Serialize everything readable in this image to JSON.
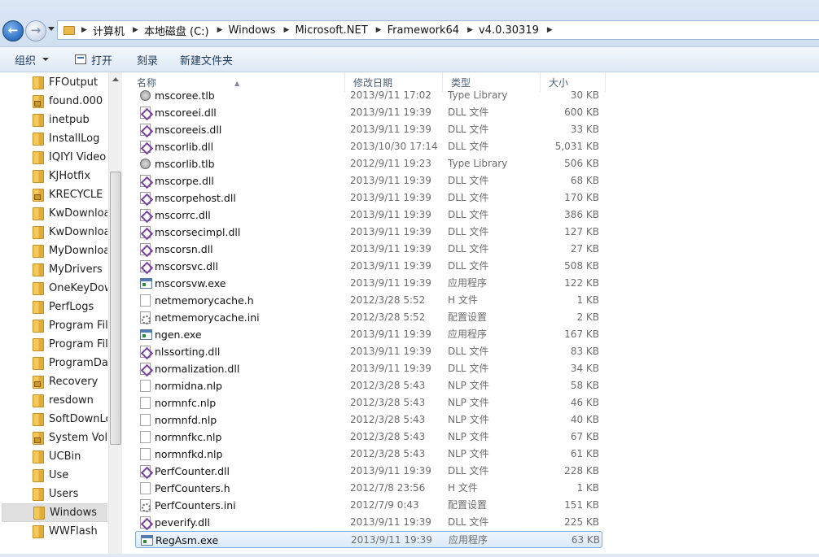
{
  "address": {
    "breadcrumbs": [
      "计算机",
      "本地磁盘 (C:)",
      "Windows",
      "Microsoft.NET",
      "Framework64",
      "v4.0.30319"
    ]
  },
  "toolbar": {
    "organize_label": "组织",
    "open_label": "打开",
    "burn_label": "刻录",
    "new_folder_label": "新建文件夹"
  },
  "navigation": {
    "items": [
      {
        "label": "FFOutput",
        "locked": false
      },
      {
        "label": "found.000",
        "locked": true
      },
      {
        "label": "inetpub",
        "locked": false
      },
      {
        "label": "InstallLog",
        "locked": false
      },
      {
        "label": "IQIYI Video",
        "locked": false
      },
      {
        "label": "KJHotfix",
        "locked": false
      },
      {
        "label": "KRECYCLE",
        "locked": true
      },
      {
        "label": "KwDownload",
        "locked": false
      },
      {
        "label": "KwDownload",
        "locked": false
      },
      {
        "label": "MyDownloads",
        "locked": false
      },
      {
        "label": "MyDrivers",
        "locked": false
      },
      {
        "label": "OneKeyDown",
        "locked": false
      },
      {
        "label": "PerfLogs",
        "locked": false
      },
      {
        "label": "Program Files",
        "locked": false
      },
      {
        "label": "Program Files",
        "locked": false
      },
      {
        "label": "ProgramData",
        "locked": false
      },
      {
        "label": "Recovery",
        "locked": true
      },
      {
        "label": "resdown",
        "locked": false
      },
      {
        "label": "SoftDownLoad",
        "locked": false
      },
      {
        "label": "System Volume",
        "locked": true
      },
      {
        "label": "UCBin",
        "locked": false
      },
      {
        "label": "Use",
        "locked": false
      },
      {
        "label": "Users",
        "locked": false
      },
      {
        "label": "Windows",
        "locked": false
      },
      {
        "label": "WWFlash",
        "locked": false
      }
    ],
    "selected_index": 23
  },
  "file_list": {
    "columns": {
      "name": "名称",
      "date": "修改日期",
      "type": "类型",
      "size": "大小"
    },
    "rows": [
      {
        "name": "mscoree.tlb",
        "date": "2013/9/11 17:02",
        "type": "Type Library",
        "size": "30 KB",
        "icon": "tlb"
      },
      {
        "name": "mscoreei.dll",
        "date": "2013/9/11 19:39",
        "type": "DLL 文件",
        "size": "600 KB",
        "icon": "dll"
      },
      {
        "name": "mscoreeis.dll",
        "date": "2013/9/11 19:39",
        "type": "DLL 文件",
        "size": "33 KB",
        "icon": "dll"
      },
      {
        "name": "mscorlib.dll",
        "date": "2013/10/30 17:14",
        "type": "DLL 文件",
        "size": "5,031 KB",
        "icon": "dll"
      },
      {
        "name": "mscorlib.tlb",
        "date": "2012/9/11 19:23",
        "type": "Type Library",
        "size": "506 KB",
        "icon": "tlb"
      },
      {
        "name": "mscorpe.dll",
        "date": "2013/9/11 19:39",
        "type": "DLL 文件",
        "size": "68 KB",
        "icon": "dll"
      },
      {
        "name": "mscorpehost.dll",
        "date": "2013/9/11 19:39",
        "type": "DLL 文件",
        "size": "170 KB",
        "icon": "dll"
      },
      {
        "name": "mscorrc.dll",
        "date": "2013/9/11 19:39",
        "type": "DLL 文件",
        "size": "386 KB",
        "icon": "dll"
      },
      {
        "name": "mscorsecimpl.dll",
        "date": "2013/9/11 19:39",
        "type": "DLL 文件",
        "size": "127 KB",
        "icon": "dll"
      },
      {
        "name": "mscorsn.dll",
        "date": "2013/9/11 19:39",
        "type": "DLL 文件",
        "size": "27 KB",
        "icon": "dll"
      },
      {
        "name": "mscorsvc.dll",
        "date": "2013/9/11 19:39",
        "type": "DLL 文件",
        "size": "508 KB",
        "icon": "dll"
      },
      {
        "name": "mscorsvw.exe",
        "date": "2013/9/11 19:39",
        "type": "应用程序",
        "size": "122 KB",
        "icon": "exe"
      },
      {
        "name": "netmemorycache.h",
        "date": "2012/3/28 5:52",
        "type": "H 文件",
        "size": "1 KB",
        "icon": "h"
      },
      {
        "name": "netmemorycache.ini",
        "date": "2012/3/28 5:52",
        "type": "配置设置",
        "size": "2 KB",
        "icon": "ini"
      },
      {
        "name": "ngen.exe",
        "date": "2013/9/11 19:39",
        "type": "应用程序",
        "size": "167 KB",
        "icon": "exe"
      },
      {
        "name": "nlssorting.dll",
        "date": "2013/9/11 19:39",
        "type": "DLL 文件",
        "size": "83 KB",
        "icon": "dll"
      },
      {
        "name": "normalization.dll",
        "date": "2013/9/11 19:39",
        "type": "DLL 文件",
        "size": "34 KB",
        "icon": "dll"
      },
      {
        "name": "normidna.nlp",
        "date": "2012/3/28 5:43",
        "type": "NLP 文件",
        "size": "58 KB",
        "icon": "nlp"
      },
      {
        "name": "normnfc.nlp",
        "date": "2012/3/28 5:43",
        "type": "NLP 文件",
        "size": "46 KB",
        "icon": "nlp"
      },
      {
        "name": "normnfd.nlp",
        "date": "2012/3/28 5:43",
        "type": "NLP 文件",
        "size": "40 KB",
        "icon": "nlp"
      },
      {
        "name": "normnfkc.nlp",
        "date": "2012/3/28 5:43",
        "type": "NLP 文件",
        "size": "67 KB",
        "icon": "nlp"
      },
      {
        "name": "normnfkd.nlp",
        "date": "2012/3/28 5:43",
        "type": "NLP 文件",
        "size": "61 KB",
        "icon": "nlp"
      },
      {
        "name": "PerfCounter.dll",
        "date": "2013/9/11 19:39",
        "type": "DLL 文件",
        "size": "228 KB",
        "icon": "dll"
      },
      {
        "name": "PerfCounters.h",
        "date": "2012/7/8 23:56",
        "type": "H 文件",
        "size": "1 KB",
        "icon": "h"
      },
      {
        "name": "PerfCounters.ini",
        "date": "2012/7/9 0:43",
        "type": "配置设置",
        "size": "151 KB",
        "icon": "ini"
      },
      {
        "name": "peverify.dll",
        "date": "2013/9/11 19:39",
        "type": "DLL 文件",
        "size": "225 KB",
        "icon": "dll"
      },
      {
        "name": "RegAsm.exe",
        "date": "2013/9/11 19:39",
        "type": "应用程序",
        "size": "63 KB",
        "icon": "exe"
      }
    ],
    "selected_index": 26
  }
}
